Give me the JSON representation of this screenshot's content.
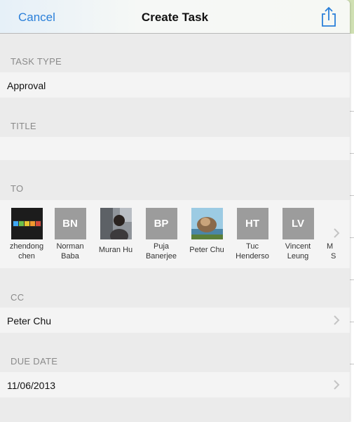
{
  "nav": {
    "cancel_label": "Cancel",
    "title": "Create Task",
    "share_icon": "share-icon"
  },
  "task_type": {
    "label": "TASK TYPE",
    "value": "Approval"
  },
  "title_field": {
    "label": "TITLE",
    "value": ""
  },
  "to": {
    "label": "TO",
    "contacts": [
      {
        "name_line1": "zhendong",
        "name_line2": "chen",
        "avatar": "photo"
      },
      {
        "name_line1": "Norman",
        "name_line2": "Baba",
        "initials": "BN"
      },
      {
        "name_line1": "Muran Hu",
        "name_line2": "",
        "avatar": "photo"
      },
      {
        "name_line1": "Puja",
        "name_line2": "Banerjee",
        "initials": "BP"
      },
      {
        "name_line1": "Peter Chu",
        "name_line2": "",
        "avatar": "photo"
      },
      {
        "name_line1": "Tuc",
        "name_line2": "Henderso",
        "initials": "HT"
      },
      {
        "name_line1": "Vincent",
        "name_line2": "Leung",
        "initials": "LV"
      },
      {
        "name_line1": "M",
        "name_line2": "S",
        "initials": ""
      }
    ]
  },
  "cc": {
    "label": "CC",
    "value": "Peter Chu"
  },
  "due_date": {
    "label": "DUE DATE",
    "value": "11/06/2013"
  },
  "colors": {
    "accent": "#2a7fd9",
    "avatar_gray": "#9c9c9c"
  }
}
